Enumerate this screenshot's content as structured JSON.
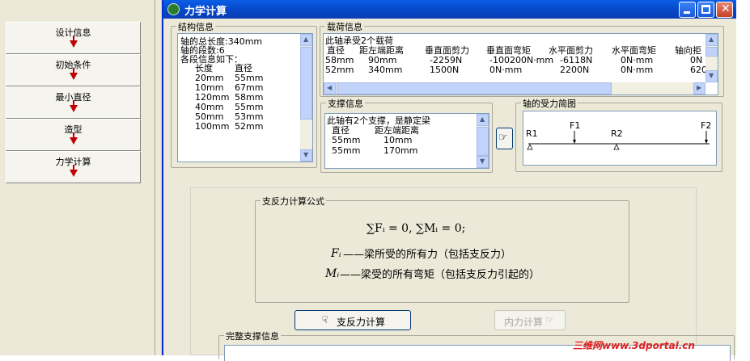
{
  "steps": [
    "设计信息",
    "初始条件",
    "最小直径",
    "造型",
    "力学计算"
  ],
  "window": {
    "title": "力学计算"
  },
  "structure": {
    "label": "结构信息",
    "total_length": "轴的总长度:340mm",
    "segments": "轴的段数:6",
    "each": "各段信息如下：",
    "col_length": "长度",
    "col_diameter": "直径",
    "rows": [
      [
        "20mm",
        "55mm"
      ],
      [
        "10mm",
        "67mm"
      ],
      [
        "120mm",
        "58mm"
      ],
      [
        "40mm",
        "55mm"
      ],
      [
        "50mm",
        "53mm"
      ],
      [
        "100mm",
        "52mm"
      ]
    ]
  },
  "load": {
    "label": "载荷信息",
    "summary": "此轴承受2个载荷",
    "headers": [
      "直径",
      "距左端距离",
      "垂直面剪力",
      "垂直面弯矩",
      "水平面剪力",
      "水平面弯矩",
      "轴向拒"
    ],
    "rows": [
      [
        "58mm",
        "90mm",
        "-2259N",
        "-100200N·mm",
        "-6118N",
        "0N·mm",
        "0N"
      ],
      [
        "52mm",
        "340mm",
        "1500N",
        "0N·mm",
        "2200N",
        "0N·mm",
        "620"
      ]
    ]
  },
  "support": {
    "label": "支撑信息",
    "summary": "此轴有2个支撑，是静定梁",
    "col_diameter": "直径",
    "col_distance": "距左端距离",
    "rows": [
      [
        "55mm",
        "10mm"
      ],
      [
        "55mm",
        "170mm"
      ]
    ]
  },
  "diagram": {
    "label": "轴的受力简图",
    "r1": "R1",
    "f1": "F1",
    "r2": "R2",
    "f2": "F2"
  },
  "formula": {
    "label": "支反力计算公式",
    "eq": "∑Fᵢ = 0, ∑Mᵢ = 0;",
    "f_sym": "Fᵢ",
    "f_desc": "——梁所受的所有力（包括支反力）",
    "m_sym": "Mᵢ",
    "m_desc": "——梁受的所有弯矩（包括支反力引起的）"
  },
  "buttons": {
    "calc_support": "支反力计算",
    "calc_internal": "内力计算"
  },
  "complete": {
    "label": "完整支撑信息"
  },
  "watermark": "三维网www.3dportal.cn",
  "colors": {
    "title_bar": "#0645c6",
    "arrow": "#c00000",
    "watermark": "#e02020"
  }
}
